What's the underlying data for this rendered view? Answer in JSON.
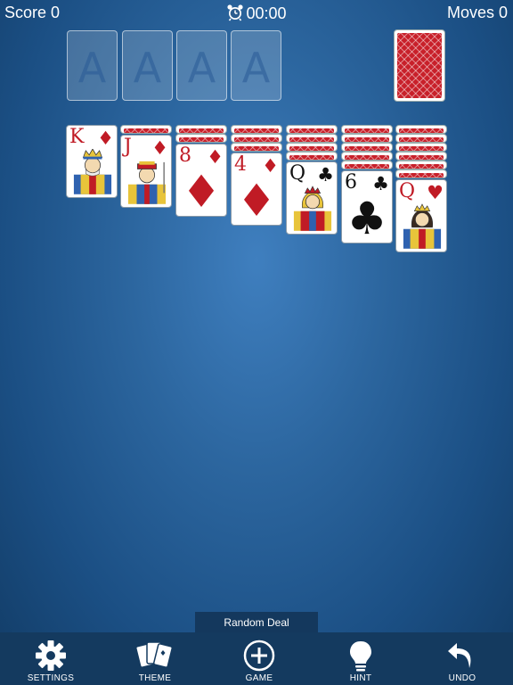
{
  "header": {
    "score_label": "Score 0",
    "time": "00:00",
    "moves_label": "Moves 0"
  },
  "foundations": [
    {
      "placeholder": "A"
    },
    {
      "placeholder": "A"
    },
    {
      "placeholder": "A"
    },
    {
      "placeholder": "A"
    }
  ],
  "stock": {
    "state": "face-down",
    "back_color": "#c8202a"
  },
  "tableau": [
    {
      "face_down": 0,
      "top_card": {
        "rank": "K",
        "suit": "♦",
        "color": "red"
      }
    },
    {
      "face_down": 1,
      "top_card": {
        "rank": "J",
        "suit": "♦",
        "color": "red"
      }
    },
    {
      "face_down": 2,
      "top_card": {
        "rank": "8",
        "suit": "♦",
        "color": "red"
      }
    },
    {
      "face_down": 3,
      "top_card": {
        "rank": "4",
        "suit": "♦",
        "color": "red"
      }
    },
    {
      "face_down": 4,
      "top_card": {
        "rank": "Q",
        "suit": "♣",
        "color": "black"
      }
    },
    {
      "face_down": 5,
      "top_card": {
        "rank": "6",
        "suit": "♣",
        "color": "black"
      }
    },
    {
      "face_down": 6,
      "top_card": {
        "rank": "Q",
        "suit": "♥",
        "color": "red"
      }
    }
  ],
  "banner": {
    "label": "Random Deal"
  },
  "toolbar": {
    "items": [
      {
        "label": "SETTINGS",
        "icon": "gear-icon"
      },
      {
        "label": "THEME",
        "icon": "cards-icon"
      },
      {
        "label": "GAME",
        "icon": "plus-circle-icon"
      },
      {
        "label": "HINT",
        "icon": "lightbulb-icon"
      },
      {
        "label": "UNDO",
        "icon": "undo-icon"
      }
    ]
  },
  "colors": {
    "table": "#2c669f",
    "card_back": "#c8202a",
    "red_suit": "#c01b25",
    "toolbar": "#143a5f"
  }
}
